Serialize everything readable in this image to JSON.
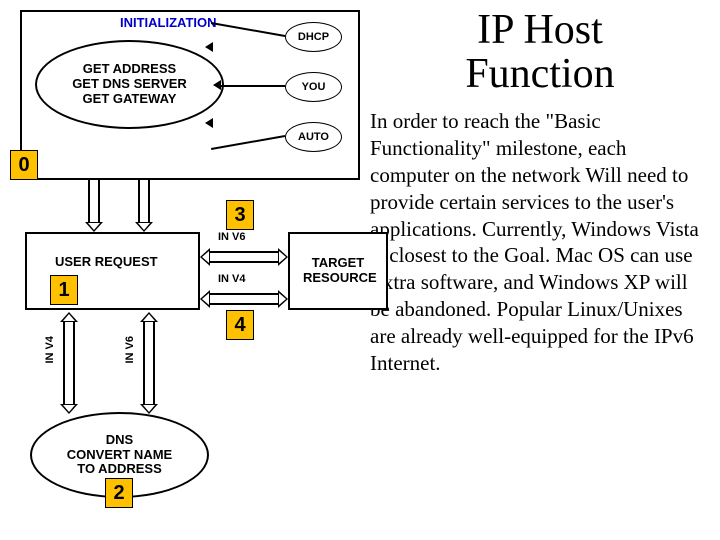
{
  "title": "IP Host Function",
  "body": "In order to reach the \"Basic Functionality\" milestone, each computer on the network Will need to provide certain services to the user's applications. Currently, Windows Vista is closest to the Goal. Mac OS can use Extra software, and Windows XP will be abandoned. Popular Linux/Unixes are already well-equipped for the IPv6 Internet.",
  "init_label": "INITIALIZATION",
  "init_actions": [
    "GET ADDRESS",
    "GET DNS SERVER",
    "GET GATEWAY"
  ],
  "init_sources": {
    "dhcp": "DHCP",
    "you": "YOU",
    "auto": "AUTO"
  },
  "user_request": "USER REQUEST",
  "dns_block": [
    "DNS",
    "CONVERT NAME",
    "TO ADDRESS"
  ],
  "target": [
    "TARGET",
    "RESOURCE"
  ],
  "steps": {
    "s0": "0",
    "s1": "1",
    "s2": "2",
    "s3": "3",
    "s4": "4"
  },
  "lane": {
    "inv6": "IN V6",
    "inv4": "IN V4"
  }
}
